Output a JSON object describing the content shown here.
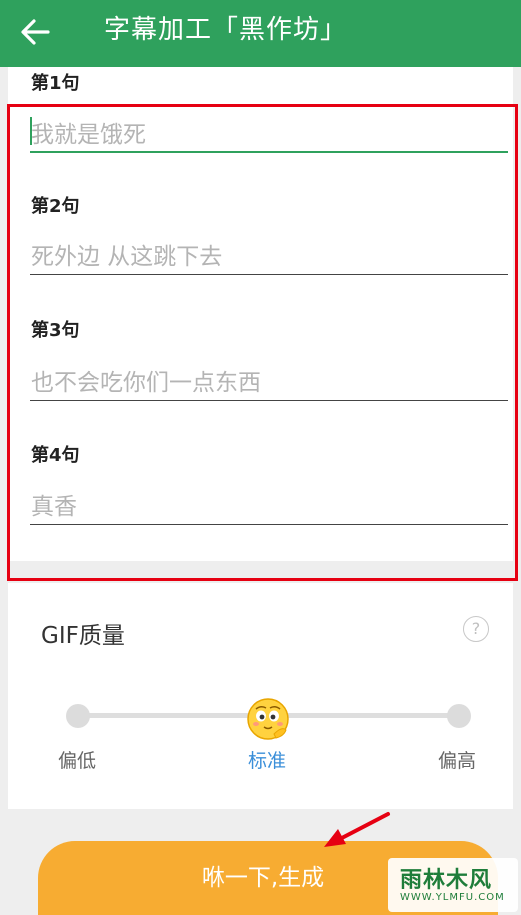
{
  "header": {
    "title": "字幕加工「黑作坊」",
    "back_icon": "arrow-left-icon",
    "bg_color": "#2fa15d"
  },
  "sentences": [
    {
      "label": "第1句",
      "placeholder": "我就是饿死",
      "active": true
    },
    {
      "label": "第2句",
      "placeholder": "死外边 从这跳下去",
      "active": false
    },
    {
      "label": "第3句",
      "placeholder": "也不会吃你们一点东西",
      "active": false
    },
    {
      "label": "第4句",
      "placeholder": "真香",
      "active": false
    }
  ],
  "quality": {
    "title": "GIF质量",
    "help_icon": "question-circle-icon",
    "help_glyph": "?",
    "levels": [
      "偏低",
      "标准",
      "偏高"
    ],
    "selected_index": 1,
    "thumb_icon": "emoji-face-icon"
  },
  "generate": {
    "label": "咻一下,生成",
    "color": "#f7ac32"
  },
  "watermark": {
    "main": "雨林木风",
    "sub": "WWW.YLMFU.COM"
  },
  "colors": {
    "accent_green": "#2fa15d",
    "highlight_red": "#e60012",
    "selected_blue": "#3b8fd9"
  }
}
